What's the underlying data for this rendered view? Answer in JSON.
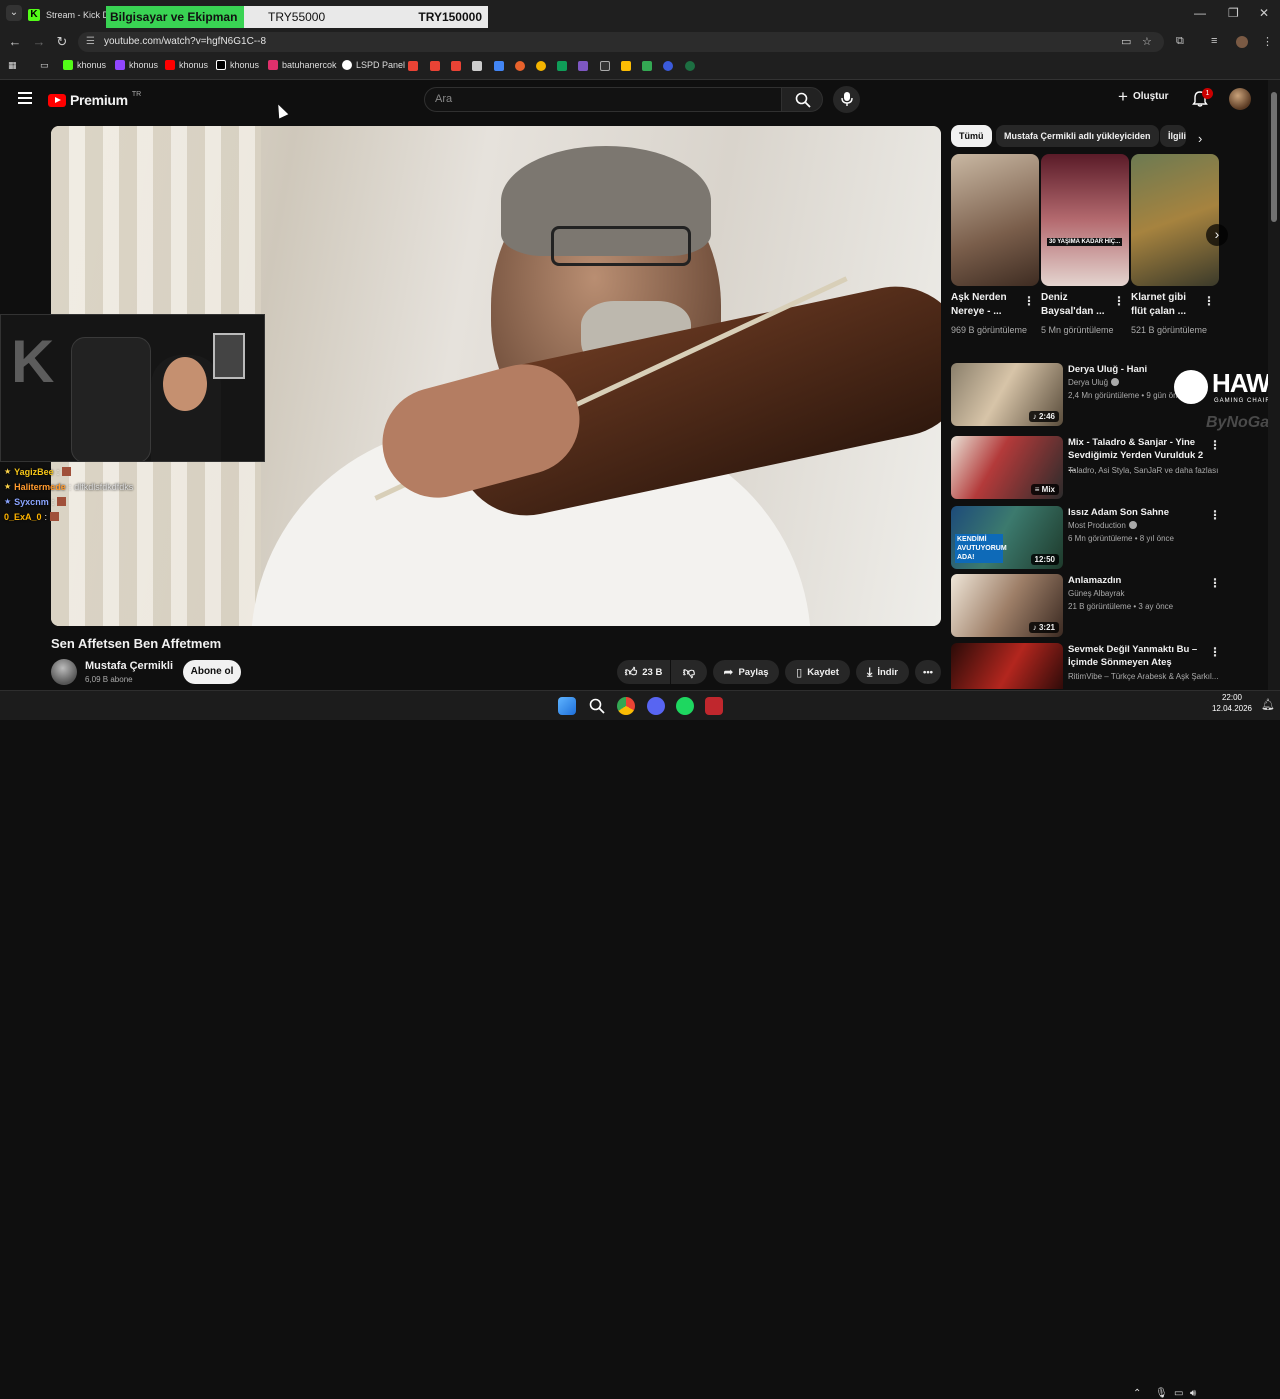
{
  "browser": {
    "tab_title": "Stream - Kick D",
    "price_banner": {
      "label": "Bilgisayar ve Ekipman",
      "price_min": "TRY55000",
      "price_max": "TRY150000"
    },
    "url": "youtube.com/watch?v=hgfN6G1C--8",
    "bookmarks": [
      {
        "label": "khonus",
        "icon": "kick-icon",
        "color": "#53fc18"
      },
      {
        "label": "khonus",
        "icon": "twitch-icon",
        "color": "#9146ff"
      },
      {
        "label": "khonus",
        "icon": "youtube-icon",
        "color": "#ff0000"
      },
      {
        "label": "khonus",
        "icon": "x-icon",
        "color": "#ffffff"
      },
      {
        "label": "batuhanercok",
        "icon": "instagram-icon",
        "color": "#e1306c"
      },
      {
        "label": "LSPD Panel",
        "icon": "lspd-icon",
        "color": "#ffffff"
      }
    ]
  },
  "youtube": {
    "logo_text": "Premium",
    "logo_region": "TR",
    "search_placeholder": "Ara",
    "create_label": "Oluştur",
    "notification_count": "1"
  },
  "video": {
    "title": "Sen Affetsen Ben Affetmem",
    "channel": "Mustafa Çermikli",
    "subscribers": "6,09 B abone",
    "subscribe_label": "Abone ol",
    "likes": "23 B",
    "share_label": "Paylaş",
    "save_label": "Kaydet",
    "download_label": "İndir"
  },
  "stream_chat": [
    {
      "user": "YagizBee",
      "color": "#f5c518",
      "msg": ""
    },
    {
      "user": "Halitermede",
      "color": "#ff9a2e",
      "msg": "dlfkdlsfdkdfdks"
    },
    {
      "user": "Syxcnm",
      "color": "#8aa4ff",
      "msg": ""
    },
    {
      "user": "0_ExA_0",
      "color": "#ffb400",
      "msg": ""
    }
  ],
  "sidebar": {
    "chips": [
      "Tümü",
      "Mustafa Çermikli adlı yükleyiciden",
      "İlgili"
    ],
    "shelf": [
      {
        "title": "Aşk Nerden Nereye - ...",
        "views": "969 B görüntüleme"
      },
      {
        "title": "Deniz Baysal'dan ...",
        "views": "5 Mn görüntüleme",
        "overlay": "30 YAŞIMA KADAR HİÇ..."
      },
      {
        "title": "Klarnet gibi flüt çalan ...",
        "views": "521 B görüntüleme"
      }
    ],
    "recommendations": [
      {
        "title": "Derya Uluğ - Hani",
        "channel": "Derya Uluğ",
        "meta": "2,4 Mn görüntüleme • 9 gün önce",
        "duration": "2:46"
      },
      {
        "title": "Mix - Taladro & Sanjar - Yine Sevdiğimiz Yerden Vurulduk 2 ...",
        "channel": "Taladro, Asi Styla, SanJaR ve daha fazlası",
        "meta": "",
        "duration": "Mix"
      },
      {
        "title": "Issız Adam Son Sahne",
        "channel": "Most Production",
        "meta": "6 Mn görüntüleme • 8 yıl önce",
        "duration": "12:50",
        "overlay": "KENDİMİ AVUTUYORUM ADA!"
      },
      {
        "title": "Anlamazdın",
        "channel": "Güneş Albayrak",
        "meta": "21 B görüntüleme • 3 ay önce",
        "duration": "3:21"
      },
      {
        "title": "Sevmek Değil Yanmaktı Bu – İçimde Sönmeyen Ateş",
        "channel": "RitimVibe – Türkçe Arabesk & Aşk Şarkıl...",
        "meta": "",
        "duration": ""
      }
    ]
  },
  "sponsor": {
    "brand": "HAWK",
    "sub": "GAMING CHAIR",
    "partner": "ByNoGame"
  },
  "taskbar": {
    "time": "22:00",
    "date": "12.04.2026"
  }
}
